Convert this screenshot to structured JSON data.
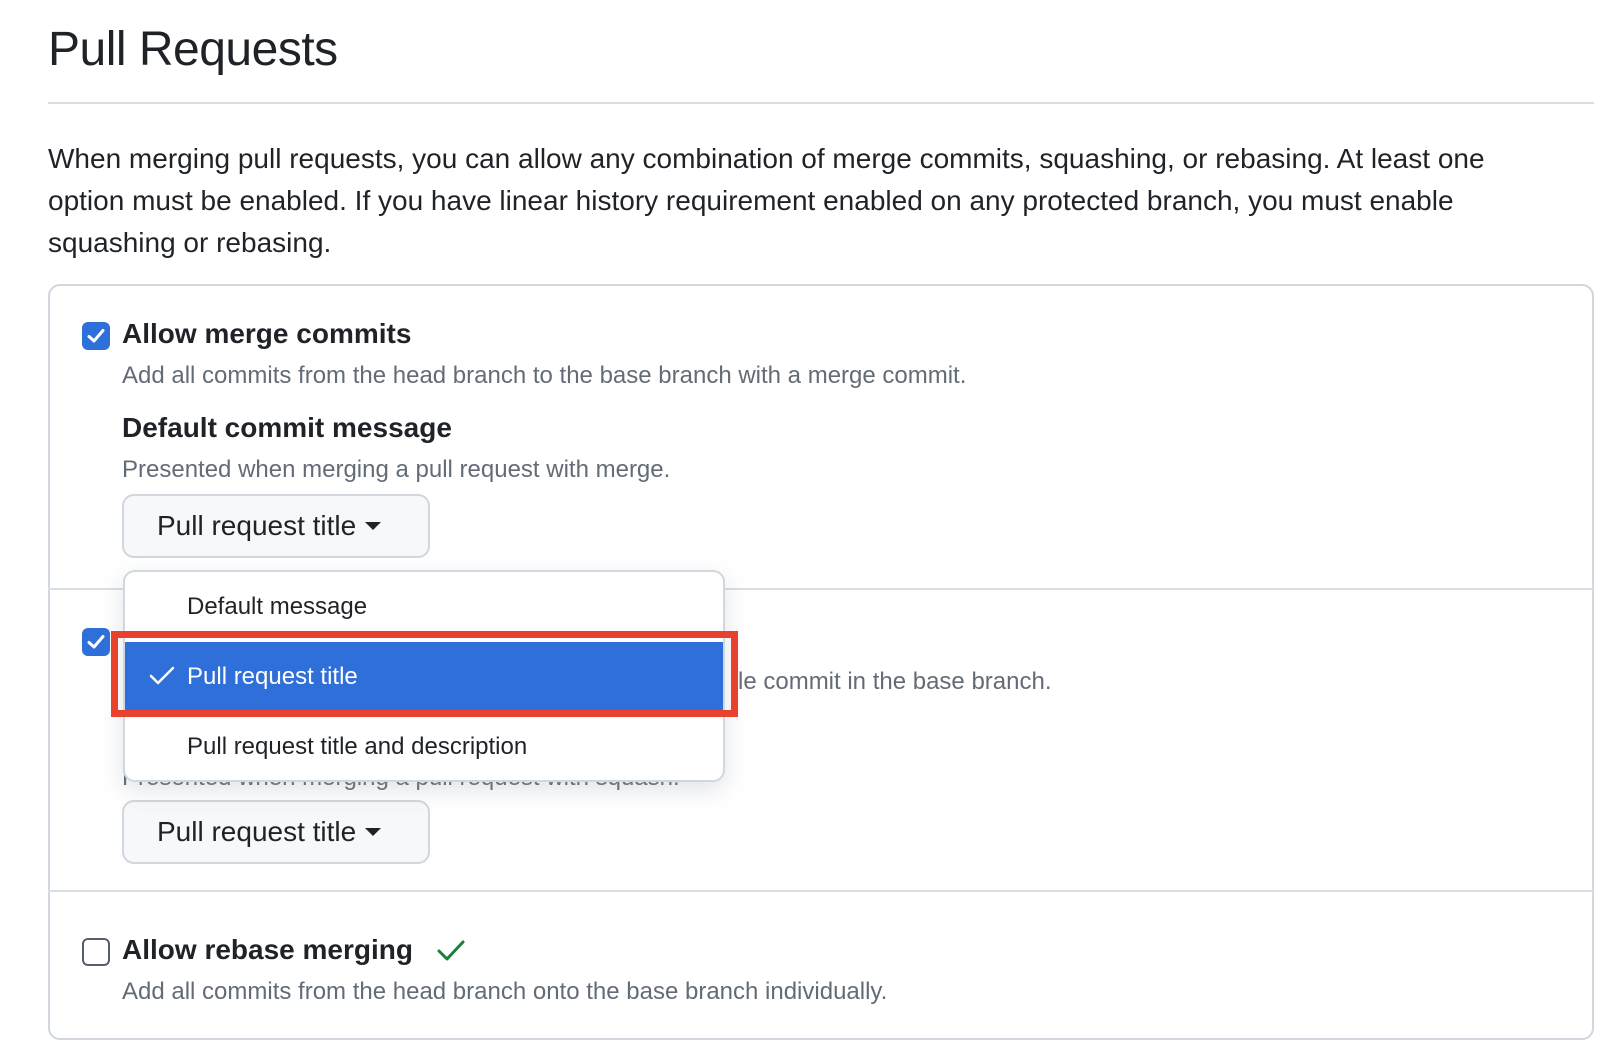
{
  "page": {
    "title": "Pull Requests",
    "intro": "When merging pull requests, you can allow any combination of merge commits, squashing, or rebasing. At least one option must be enabled. If you have linear history requirement enabled on any protected branch, you must enable squashing or rebasing."
  },
  "merge_commits": {
    "checked": true,
    "label": "Allow merge commits",
    "description": "Add all commits from the head branch to the base branch with a merge commit.",
    "default_message_title": "Default commit message",
    "default_message_desc": "Presented when merging a pull request with merge.",
    "selected_value": "Pull request title"
  },
  "squash": {
    "checked": true,
    "description_visible_fragment": "le commit in the base branch.",
    "default_message_desc_fragment": "Presented when merging a pull request with squash.",
    "selected_value": "Pull request title"
  },
  "rebase": {
    "checked": false,
    "label": "Allow rebase merging",
    "description": "Add all commits from the head branch onto the base branch individually.",
    "status_icon": "check-icon"
  },
  "dropdown_menu": {
    "items": [
      {
        "label": "Default message",
        "selected": false
      },
      {
        "label": "Pull request title",
        "selected": true
      },
      {
        "label": "Pull request title and description",
        "selected": false
      }
    ]
  },
  "colors": {
    "accent": "#2f6fd9",
    "highlight": "#e8412d",
    "success": "#1a7f37",
    "muted_text": "#636c76"
  }
}
